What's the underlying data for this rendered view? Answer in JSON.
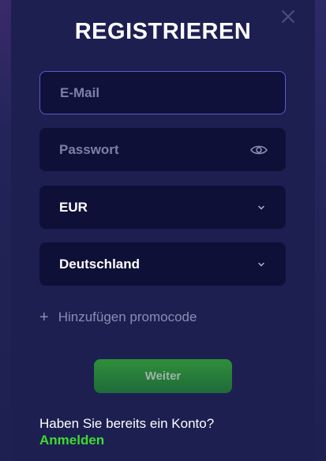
{
  "modal": {
    "title": "REGISTRIEREN",
    "email": {
      "placeholder": "E-Mail",
      "value": ""
    },
    "password": {
      "placeholder": "Passwort",
      "value": ""
    },
    "currency": {
      "selected": "EUR"
    },
    "country": {
      "selected": "Deutschland"
    },
    "promo": {
      "plus": "+",
      "label": "Hinzufügen promocode"
    },
    "submit_label": "Weiter",
    "account_question": "Haben Sie bereits ein Konto?",
    "login_label": "Anmelden"
  },
  "colors": {
    "background": "#1d1f51",
    "field_bg": "#0f1038",
    "focus_border": "#5b59c9",
    "accent_green": "#3ddc2f",
    "button_green": "#2f8f3a"
  },
  "icons": {
    "close": "close-icon",
    "password_toggle": "eye-icon",
    "dropdown": "chevron-down-icon"
  }
}
